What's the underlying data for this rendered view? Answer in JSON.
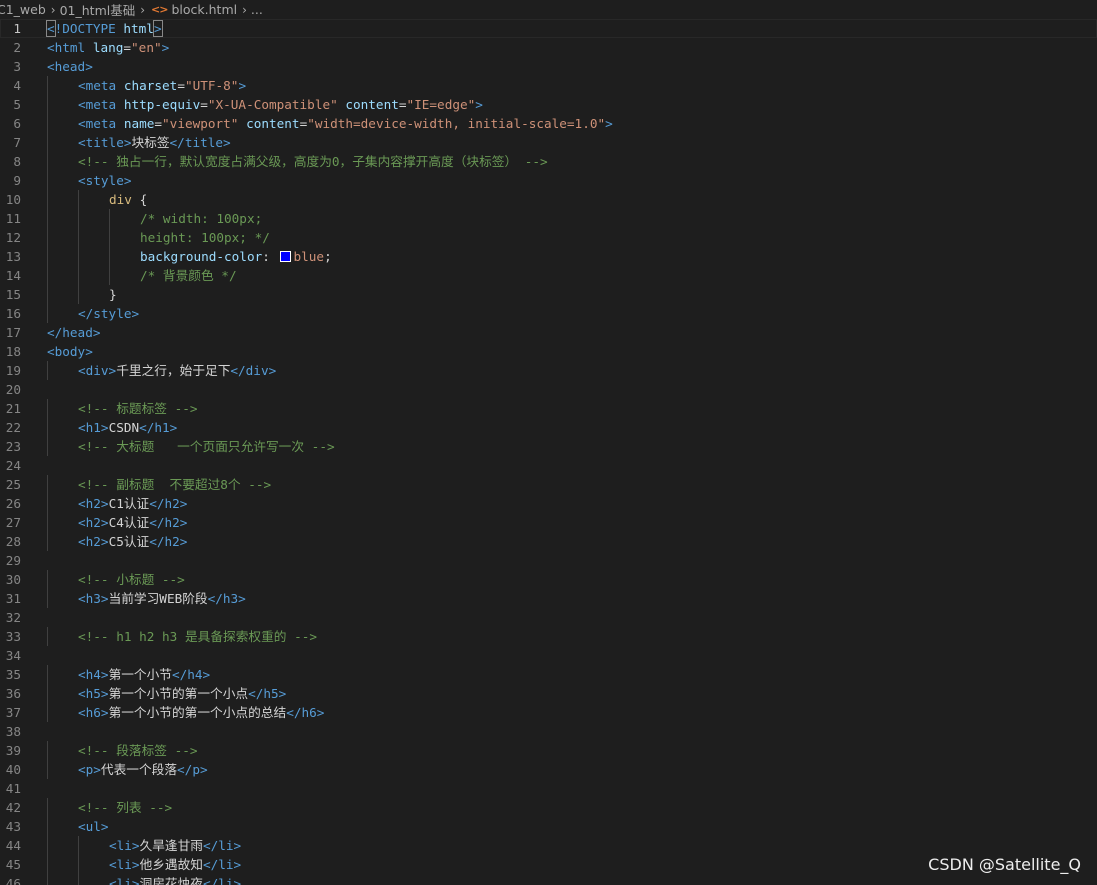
{
  "breadcrumb": {
    "items": [
      "C1_web",
      "01_html基础",
      "block.html",
      "..."
    ],
    "file_icon": "<>"
  },
  "watermark": "CSDN @Satellite_Q",
  "colors": {
    "swatch": "#0000ff"
  },
  "lines": [
    {
      "n": "1",
      "indent": 0,
      "tokens": [
        [
          "tag",
          "<"
        ],
        [
          "tag",
          "!DOCTYPE "
        ],
        [
          "attr",
          "html"
        ],
        [
          "tag",
          ">"
        ]
      ]
    },
    {
      "n": "2",
      "indent": 0,
      "tokens": [
        [
          "tag",
          "<html "
        ],
        [
          "attr",
          "lang"
        ],
        [
          "txt",
          "="
        ],
        [
          "str",
          "\"en\""
        ],
        [
          "tag",
          ">"
        ]
      ]
    },
    {
      "n": "3",
      "indent": 0,
      "tokens": [
        [
          "tag",
          "<head>"
        ]
      ]
    },
    {
      "n": "4",
      "indent": 1,
      "tokens": [
        [
          "tag",
          "<meta "
        ],
        [
          "attr",
          "charset"
        ],
        [
          "txt",
          "="
        ],
        [
          "str",
          "\"UTF-8\""
        ],
        [
          "tag",
          ">"
        ]
      ]
    },
    {
      "n": "5",
      "indent": 1,
      "tokens": [
        [
          "tag",
          "<meta "
        ],
        [
          "attr",
          "http-equiv"
        ],
        [
          "txt",
          "="
        ],
        [
          "str",
          "\"X-UA-Compatible\" "
        ],
        [
          "attr",
          "content"
        ],
        [
          "txt",
          "="
        ],
        [
          "str",
          "\"IE=edge\""
        ],
        [
          "tag",
          ">"
        ]
      ]
    },
    {
      "n": "6",
      "indent": 1,
      "tokens": [
        [
          "tag",
          "<meta "
        ],
        [
          "attr",
          "name"
        ],
        [
          "txt",
          "="
        ],
        [
          "str",
          "\"viewport\" "
        ],
        [
          "attr",
          "content"
        ],
        [
          "txt",
          "="
        ],
        [
          "str",
          "\"width=device-width, initial-scale=1.0\""
        ],
        [
          "tag",
          ">"
        ]
      ]
    },
    {
      "n": "7",
      "indent": 1,
      "tokens": [
        [
          "tag",
          "<title>"
        ],
        [
          "txt",
          "块标签"
        ],
        [
          "tag",
          "</title>"
        ]
      ]
    },
    {
      "n": "8",
      "indent": 1,
      "tokens": [
        [
          "cmt",
          "<!-- 独占一行，默认宽度占满父级，高度为0，子集内容撑开高度（块标签） -->"
        ]
      ]
    },
    {
      "n": "9",
      "indent": 1,
      "tokens": [
        [
          "tag",
          "<style>"
        ]
      ]
    },
    {
      "n": "10",
      "indent": 2,
      "tokens": [
        [
          "sel",
          "div "
        ],
        [
          "txt",
          "{"
        ]
      ]
    },
    {
      "n": "11",
      "indent": 3,
      "tokens": [
        [
          "cmt",
          "/* width: 100px;"
        ]
      ]
    },
    {
      "n": "12",
      "indent": 3,
      "tokens": [
        [
          "cmt",
          "height: 100px; */"
        ]
      ]
    },
    {
      "n": "13",
      "indent": 3,
      "tokens": [
        [
          "prop",
          "background-color"
        ],
        [
          "txt",
          ": "
        ],
        [
          "swatch",
          ""
        ],
        [
          "val",
          "blue"
        ],
        [
          "txt",
          ";"
        ]
      ]
    },
    {
      "n": "14",
      "indent": 3,
      "tokens": [
        [
          "cmt",
          "/* 背景颜色 */"
        ]
      ]
    },
    {
      "n": "15",
      "indent": 2,
      "tokens": [
        [
          "txt",
          "}"
        ]
      ]
    },
    {
      "n": "16",
      "indent": 1,
      "tokens": [
        [
          "tag",
          "</style>"
        ]
      ]
    },
    {
      "n": "17",
      "indent": 0,
      "tokens": [
        [
          "tag",
          "</head>"
        ]
      ]
    },
    {
      "n": "18",
      "indent": 0,
      "tokens": [
        [
          "tag",
          "<body>"
        ]
      ]
    },
    {
      "n": "19",
      "indent": 1,
      "tokens": [
        [
          "tag",
          "<div>"
        ],
        [
          "txt",
          "千里之行，始于足下"
        ],
        [
          "tag",
          "</div>"
        ]
      ]
    },
    {
      "n": "20",
      "indent": 0,
      "tokens": []
    },
    {
      "n": "21",
      "indent": 1,
      "tokens": [
        [
          "cmt",
          "<!-- 标题标签 -->"
        ]
      ]
    },
    {
      "n": "22",
      "indent": 1,
      "tokens": [
        [
          "tag",
          "<h1>"
        ],
        [
          "txt",
          "CSDN"
        ],
        [
          "tag",
          "</h1>"
        ]
      ]
    },
    {
      "n": "23",
      "indent": 1,
      "tokens": [
        [
          "cmt",
          "<!-- 大标题   一个页面只允许写一次 -->"
        ]
      ]
    },
    {
      "n": "24",
      "indent": 0,
      "tokens": []
    },
    {
      "n": "25",
      "indent": 1,
      "tokens": [
        [
          "cmt",
          "<!-- 副标题  不要超过8个 -->"
        ]
      ]
    },
    {
      "n": "26",
      "indent": 1,
      "tokens": [
        [
          "tag",
          "<h2>"
        ],
        [
          "txt",
          "C1认证"
        ],
        [
          "tag",
          "</h2>"
        ]
      ]
    },
    {
      "n": "27",
      "indent": 1,
      "tokens": [
        [
          "tag",
          "<h2>"
        ],
        [
          "txt",
          "C4认证"
        ],
        [
          "tag",
          "</h2>"
        ]
      ]
    },
    {
      "n": "28",
      "indent": 1,
      "tokens": [
        [
          "tag",
          "<h2>"
        ],
        [
          "txt",
          "C5认证"
        ],
        [
          "tag",
          "</h2>"
        ]
      ]
    },
    {
      "n": "29",
      "indent": 0,
      "tokens": []
    },
    {
      "n": "30",
      "indent": 1,
      "tokens": [
        [
          "cmt",
          "<!-- 小标题 -->"
        ]
      ]
    },
    {
      "n": "31",
      "indent": 1,
      "tokens": [
        [
          "tag",
          "<h3>"
        ],
        [
          "txt",
          "当前学习WEB阶段"
        ],
        [
          "tag",
          "</h3>"
        ]
      ]
    },
    {
      "n": "32",
      "indent": 0,
      "tokens": []
    },
    {
      "n": "33",
      "indent": 1,
      "tokens": [
        [
          "cmt",
          "<!-- h1 h2 h3 是具备探索权重的 -->"
        ]
      ]
    },
    {
      "n": "34",
      "indent": 0,
      "tokens": []
    },
    {
      "n": "35",
      "indent": 1,
      "tokens": [
        [
          "tag",
          "<h4>"
        ],
        [
          "txt",
          "第一个小节"
        ],
        [
          "tag",
          "</h4>"
        ]
      ]
    },
    {
      "n": "36",
      "indent": 1,
      "tokens": [
        [
          "tag",
          "<h5>"
        ],
        [
          "txt",
          "第一个小节的第一个小点"
        ],
        [
          "tag",
          "</h5>"
        ]
      ]
    },
    {
      "n": "37",
      "indent": 1,
      "tokens": [
        [
          "tag",
          "<h6>"
        ],
        [
          "txt",
          "第一个小节的第一个小点的总结"
        ],
        [
          "tag",
          "</h6>"
        ]
      ]
    },
    {
      "n": "38",
      "indent": 0,
      "tokens": []
    },
    {
      "n": "39",
      "indent": 1,
      "tokens": [
        [
          "cmt",
          "<!-- 段落标签 -->"
        ]
      ]
    },
    {
      "n": "40",
      "indent": 1,
      "tokens": [
        [
          "tag",
          "<p>"
        ],
        [
          "txt",
          "代表一个段落"
        ],
        [
          "tag",
          "</p>"
        ]
      ]
    },
    {
      "n": "41",
      "indent": 0,
      "tokens": []
    },
    {
      "n": "42",
      "indent": 1,
      "tokens": [
        [
          "cmt",
          "<!-- 列表 -->"
        ]
      ]
    },
    {
      "n": "43",
      "indent": 1,
      "tokens": [
        [
          "tag",
          "<ul>"
        ]
      ]
    },
    {
      "n": "44",
      "indent": 2,
      "tokens": [
        [
          "tag",
          "<li>"
        ],
        [
          "txt",
          "久旱逢甘雨"
        ],
        [
          "tag",
          "</li>"
        ]
      ]
    },
    {
      "n": "45",
      "indent": 2,
      "tokens": [
        [
          "tag",
          "<li>"
        ],
        [
          "txt",
          "他乡遇故知"
        ],
        [
          "tag",
          "</li>"
        ]
      ]
    },
    {
      "n": "46",
      "indent": 2,
      "tokens": [
        [
          "tag",
          "<li>"
        ],
        [
          "txt",
          "洞房花烛夜"
        ],
        [
          "tag",
          "</li>"
        ]
      ]
    }
  ]
}
